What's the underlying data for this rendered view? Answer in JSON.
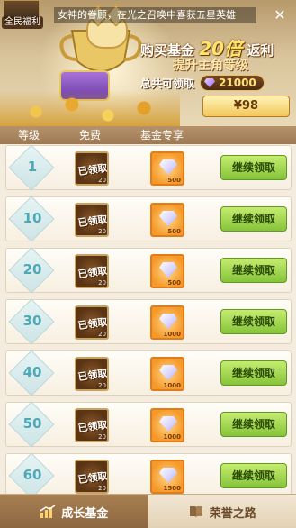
{
  "banner": {
    "avatar_label": "全民福利",
    "ticker": "女神的眷顾，在光之召唤中喜获五星英雄",
    "promo_line1_pre": "购买基金",
    "promo_line1_mult": "20倍",
    "promo_line1_post": "返利",
    "promo_line2": "提升主角等级",
    "total_label": "总共可领取",
    "total_value": "21000",
    "price_button": "¥98"
  },
  "columns": {
    "level": "等级",
    "free": "免费",
    "fund": "基金专享"
  },
  "rows": [
    {
      "level": "1",
      "free_status": "已领取",
      "free_qty": "20",
      "fund_qty": "500",
      "claim": "继续领取"
    },
    {
      "level": "10",
      "free_status": "已领取",
      "free_qty": "20",
      "fund_qty": "500",
      "claim": "继续领取"
    },
    {
      "level": "20",
      "free_status": "已领取",
      "free_qty": "20",
      "fund_qty": "500",
      "claim": "继续领取"
    },
    {
      "level": "30",
      "free_status": "已领取",
      "free_qty": "20",
      "fund_qty": "1000",
      "claim": "继续领取"
    },
    {
      "level": "40",
      "free_status": "已领取",
      "free_qty": "20",
      "fund_qty": "1000",
      "claim": "继续领取"
    },
    {
      "level": "50",
      "free_status": "已领取",
      "free_qty": "20",
      "fund_qty": "1000",
      "claim": "继续领取"
    },
    {
      "level": "60",
      "free_status": "已领取",
      "free_qty": "20",
      "fund_qty": "1500",
      "claim": "继续领取"
    }
  ],
  "tabs": [
    {
      "label": "成长基金",
      "active": true,
      "icon": "chart-growth-icon"
    },
    {
      "label": "荣誉之路",
      "active": false,
      "icon": "book-icon"
    }
  ],
  "colors": {
    "claim_button": "#86c43a",
    "level_text": "#4fa8b6",
    "tab_active": "#8c6640"
  }
}
